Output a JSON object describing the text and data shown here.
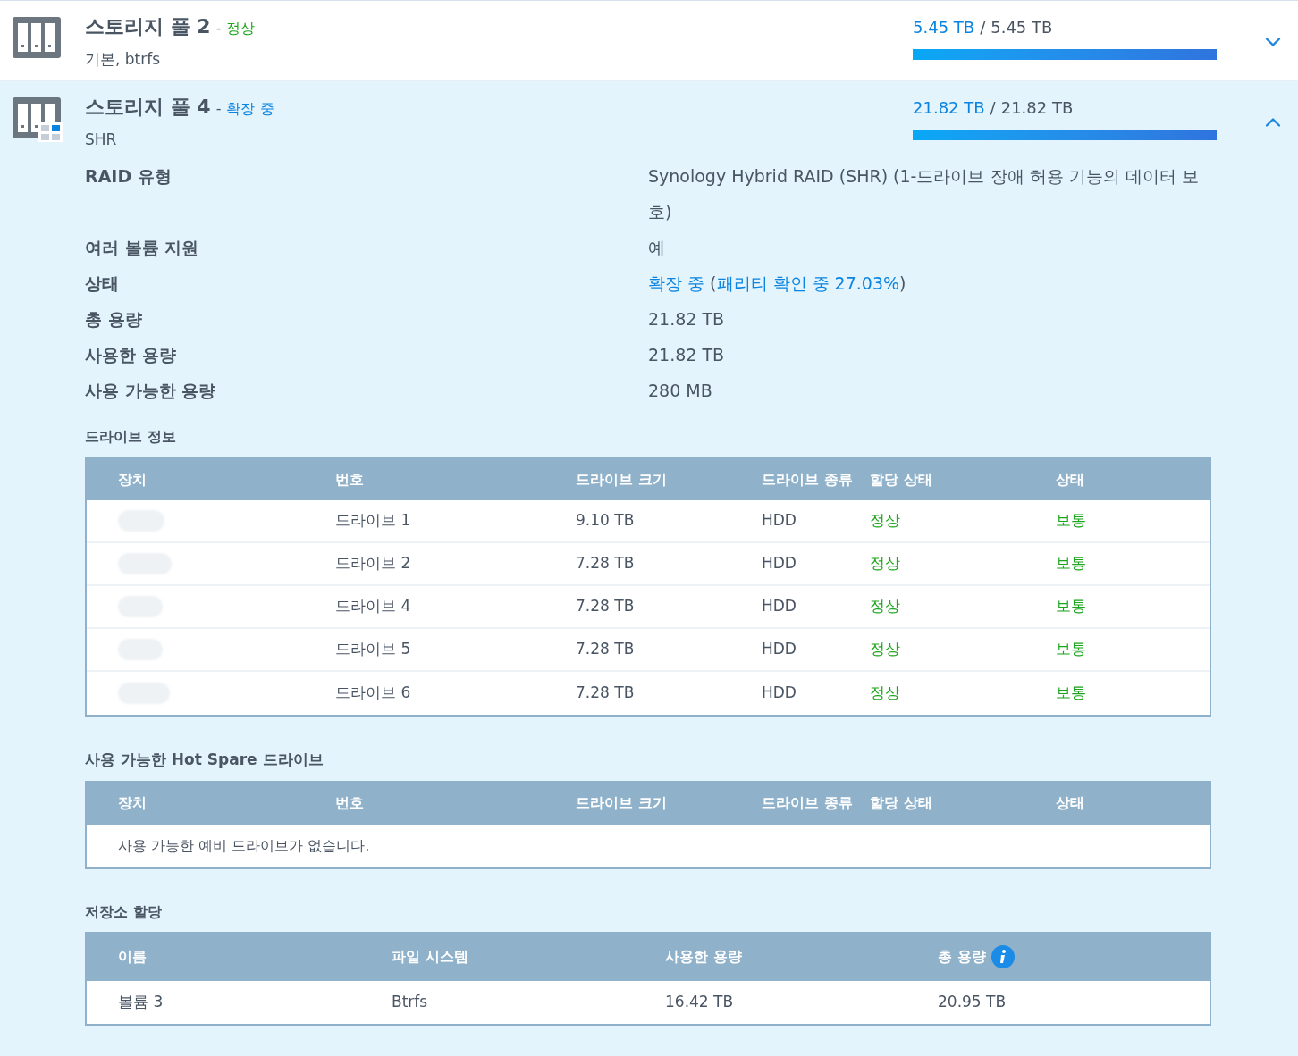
{
  "pools": [
    {
      "title": "스토리지 풀 2",
      "status": "정상",
      "dash": "-",
      "slash": "/",
      "color": "#1ea51e",
      "subtitle": "기본, btrfs",
      "used": "5.45 TB",
      "total": "5.45 TB",
      "level": 1,
      "expanded": false,
      "kind": "plain"
    },
    {
      "title": "스토리지 풀 4",
      "status": "확장 중",
      "dash": "-",
      "slash": "/",
      "color": "#0a84e0",
      "subtitle": "SHR",
      "used": "21.82 TB",
      "total": "21.82 TB",
      "level": 1,
      "expanded": true,
      "kind": "expanding"
    }
  ],
  "properties": [
    {
      "label": "RAID 유형",
      "segments": [
        {
          "text": "Synology Hybrid RAID (SHR) (1-드라이브 장애 허용 기능의 데이터 보호)",
          "highlight": false
        }
      ]
    },
    {
      "label": "여러 볼륨 지원",
      "segments": [
        {
          "text": "예",
          "highlight": false
        }
      ]
    },
    {
      "label": "상태",
      "segments": [
        {
          "text": "확장 중",
          "highlight": true
        },
        {
          "text": " (",
          "highlight": false
        },
        {
          "text": "패리티 확인 중 27.03%",
          "highlight": true
        },
        {
          "text": ")",
          "highlight": false
        }
      ]
    },
    {
      "label": "총 용량",
      "segments": [
        {
          "text": "21.82 TB",
          "highlight": false
        }
      ]
    },
    {
      "label": "사용한 용량",
      "segments": [
        {
          "text": "21.82 TB",
          "highlight": false
        }
      ]
    },
    {
      "label": "사용 가능한 용량",
      "segments": [
        {
          "text": "280 MB",
          "highlight": false
        }
      ]
    }
  ],
  "drive_info": {
    "title": "드라이브 정보",
    "columns": [
      "장치",
      "번호",
      "드라이브 크기",
      "드라이브 종류",
      "할당 상태",
      "상태"
    ],
    "rows": [
      {
        "number": "드라이브 1",
        "size": "9.10 TB",
        "type": "HDD",
        "allocation": "정상",
        "status": "보통"
      },
      {
        "number": "드라이브 2",
        "size": "7.28 TB",
        "type": "HDD",
        "allocation": "정상",
        "status": "보통"
      },
      {
        "number": "드라이브 4",
        "size": "7.28 TB",
        "type": "HDD",
        "allocation": "정상",
        "status": "보통"
      },
      {
        "number": "드라이브 5",
        "size": "7.28 TB",
        "type": "HDD",
        "allocation": "정상",
        "status": "보통"
      },
      {
        "number": "드라이브 6",
        "size": "7.28 TB",
        "type": "HDD",
        "allocation": "정상",
        "status": "보통"
      }
    ]
  },
  "hot_spare": {
    "title": "사용 가능한 Hot Spare 드라이브",
    "columns": [
      "장치",
      "번호",
      "드라이브 크기",
      "드라이브 종류",
      "할당 상태",
      "상태"
    ],
    "empty_message": "사용 가능한 예비 드라이브가 없습니다."
  },
  "allocation": {
    "title": "저장소 할당",
    "columns": [
      {
        "label": "이름",
        "kind": "plain"
      },
      {
        "label": "파일 시스템",
        "kind": "plain"
      },
      {
        "label": "사용한 용량",
        "kind": "plain"
      },
      {
        "label": "총 용량",
        "kind": "info"
      }
    ],
    "rows": [
      {
        "cells": [
          "볼륨 3",
          "Btrfs",
          "16.42 TB",
          "20.95 TB"
        ]
      }
    ]
  }
}
